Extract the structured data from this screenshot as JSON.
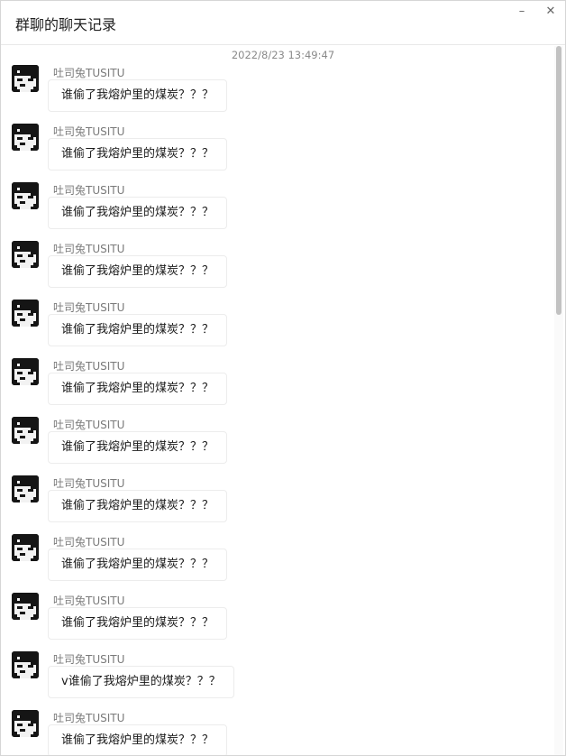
{
  "window": {
    "title": "群聊的聊天记录",
    "minimize_icon": "–",
    "close_icon": "✕"
  },
  "chat": {
    "timestamp": "2022/8/23 13:49:47",
    "messages": [
      {
        "sender": "吐司兔TUSITU",
        "text": "谁偷了我熔炉里的煤炭？？？"
      },
      {
        "sender": "吐司兔TUSITU",
        "text": "谁偷了我熔炉里的煤炭？？？"
      },
      {
        "sender": "吐司兔TUSITU",
        "text": "谁偷了我熔炉里的煤炭？？？"
      },
      {
        "sender": "吐司兔TUSITU",
        "text": "谁偷了我熔炉里的煤炭？？？"
      },
      {
        "sender": "吐司兔TUSITU",
        "text": "谁偷了我熔炉里的煤炭？？？"
      },
      {
        "sender": "吐司兔TUSITU",
        "text": "谁偷了我熔炉里的煤炭？？？"
      },
      {
        "sender": "吐司兔TUSITU",
        "text": "谁偷了我熔炉里的煤炭？？？"
      },
      {
        "sender": "吐司兔TUSITU",
        "text": "谁偷了我熔炉里的煤炭？？？"
      },
      {
        "sender": "吐司兔TUSITU",
        "text": "谁偷了我熔炉里的煤炭？？？"
      },
      {
        "sender": "吐司兔TUSITU",
        "text": "谁偷了我熔炉里的煤炭？？？"
      },
      {
        "sender": "吐司兔TUSITU",
        "text": "v谁偷了我熔炉里的煤炭？？？"
      },
      {
        "sender": "吐司兔TUSITU",
        "text": "谁偷了我熔炉里的煤炭？？？"
      }
    ]
  }
}
